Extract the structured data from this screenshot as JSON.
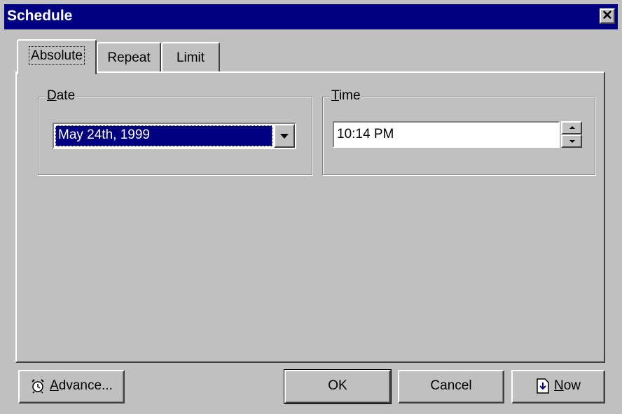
{
  "window": {
    "title": "Schedule",
    "close_glyph": "✕"
  },
  "tabs": [
    {
      "label": "Absolute",
      "active": true
    },
    {
      "label": "Repeat",
      "active": false
    },
    {
      "label": "Limit",
      "active": false
    }
  ],
  "date_group": {
    "label_accel": "D",
    "label_rest": "ate",
    "value": "May 24th, 1999"
  },
  "time_group": {
    "label_accel": "T",
    "label_rest": "ime",
    "value": "10:14 PM"
  },
  "buttons": {
    "advance": {
      "accel": "A",
      "rest": "dvance...",
      "icon": "alarm-clock-icon"
    },
    "ok": {
      "label": "OK"
    },
    "cancel": {
      "label": "Cancel"
    },
    "now": {
      "accel": "N",
      "rest": "ow",
      "icon": "insert-arrow-icon"
    }
  },
  "colors": {
    "titlebar": "#000080",
    "face": "#c0c0c0",
    "selection": "#000080"
  }
}
